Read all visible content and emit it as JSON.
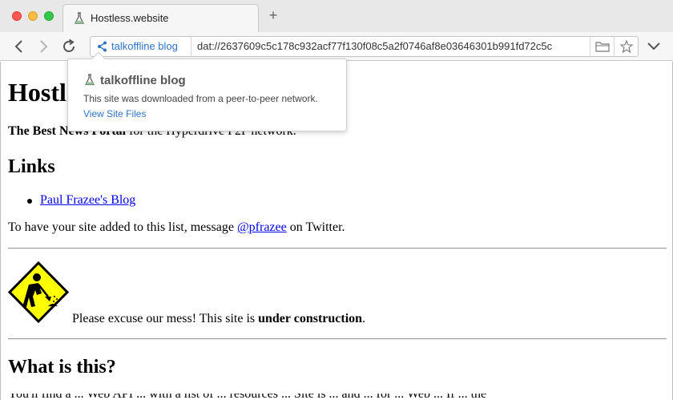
{
  "browser": {
    "tab": {
      "title": "Hostless.website",
      "icon": "flask-icon"
    },
    "new_tab_label": "+",
    "url_bar": {
      "site_name": "talkoffline blog",
      "url": "dat://2637609c5c178c932acf77f130f08c5a2f0746af8e03646301b991fd72c5c"
    }
  },
  "popover": {
    "title": "talkoffline blog",
    "description": "This site was downloaded from a peer-to-peer network.",
    "link": "View Site Files"
  },
  "page": {
    "title": "Hostless.website",
    "tagline_bold": "The Best News Portal",
    "tagline_rest": " for the Hyperdrive P2P network.",
    "links_heading": "Links",
    "links": [
      "Paul Frazee's Blog"
    ],
    "message_before": "To have your site added to this list, message ",
    "message_link": "@pfrazee",
    "message_after": " on Twitter.",
    "construction_before": "Please excuse our mess! This site is ",
    "construction_bold": "under construction",
    "construction_after": ".",
    "what_heading": "What is this?",
    "cut_text": "You'll find a ... Web API ... with a list of ... resources ... Site is ... and ... for ... Web ... If ... the"
  },
  "colors": {
    "accent_blue": "#2f74c6",
    "link_blue": "#0000ee",
    "sign_yellow": "#ffff00"
  }
}
